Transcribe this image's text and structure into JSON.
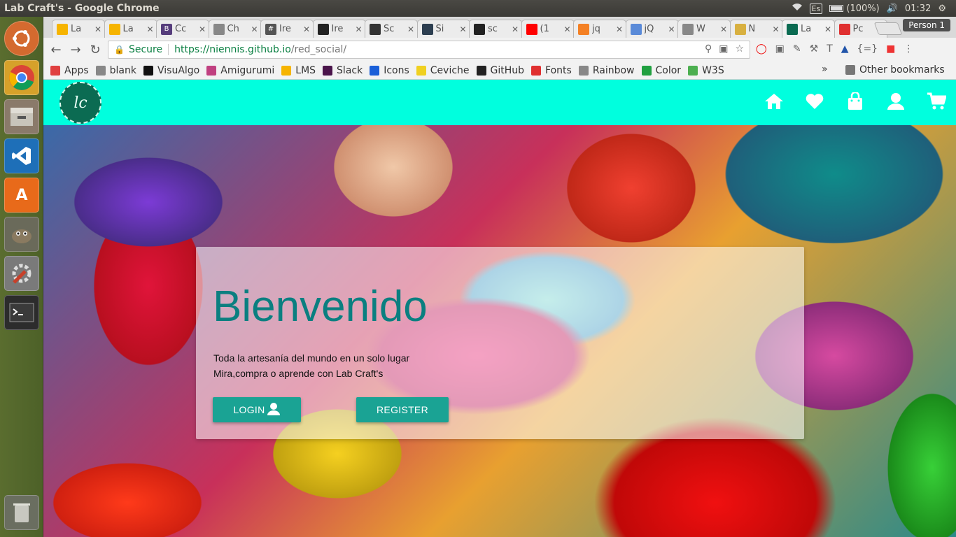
{
  "window": {
    "title": "Lab Craft's - Google Chrome"
  },
  "tray": {
    "keyboard": "Es",
    "battery": "(100%)",
    "time": "01:32"
  },
  "launcher": {
    "apps": [
      {
        "name": "ubuntu-dash-icon",
        "color": "#d46a2f"
      },
      {
        "name": "chrome-icon",
        "color": "#4285f4"
      },
      {
        "name": "files-icon",
        "color": "#8a7a6a"
      },
      {
        "name": "vscode-icon",
        "color": "#1e6fb8"
      },
      {
        "name": "software-center-icon",
        "color": "#e86a1a"
      },
      {
        "name": "gimp-icon",
        "color": "#6a6a5a"
      },
      {
        "name": "settings-icon",
        "color": "#c8402a"
      },
      {
        "name": "terminal-icon",
        "color": "#2c2c2c"
      }
    ],
    "trash": "trash-icon"
  },
  "tabs": [
    {
      "label": "La",
      "icon_color": "#f6b400"
    },
    {
      "label": "La",
      "icon_color": "#f6b400"
    },
    {
      "label": "Cc",
      "icon_color": "#563d7c",
      "glyph": "B"
    },
    {
      "label": "Ch",
      "icon_color": "#888888"
    },
    {
      "label": "Ire",
      "icon_color": "#555555",
      "glyph": "#"
    },
    {
      "label": "Ire",
      "icon_color": "#222222"
    },
    {
      "label": "Sc",
      "icon_color": "#333333"
    },
    {
      "label": "Si",
      "icon_color": "#2c3e50"
    },
    {
      "label": "sc",
      "icon_color": "#222222"
    },
    {
      "label": "(1",
      "icon_color": "#ff0000"
    },
    {
      "label": "jq",
      "icon_color": "#f48024"
    },
    {
      "label": "jQ",
      "icon_color": "#5a8ad8"
    },
    {
      "label": "W",
      "icon_color": "#888888"
    },
    {
      "label": "N",
      "icon_color": "#d8b040"
    },
    {
      "label": "La",
      "icon_color": "#0b6b52",
      "active": true
    },
    {
      "label": "Pc",
      "icon_color": "#e03030"
    }
  ],
  "profile": "Person 1",
  "address": {
    "secure_label": "Secure",
    "host": "https://niennis.github.io",
    "path": "/red_social/"
  },
  "bookmarks": [
    {
      "label": "Apps",
      "icon_color": "#e04040"
    },
    {
      "label": "blank",
      "icon_color": "#888888"
    },
    {
      "label": "VisuAlgo",
      "icon_color": "#111111"
    },
    {
      "label": "Amigurumi",
      "icon_color": "#c04080"
    },
    {
      "label": "LMS",
      "icon_color": "#f6b400"
    },
    {
      "label": "Slack",
      "icon_color": "#4a154b"
    },
    {
      "label": "Icons",
      "icon_color": "#1a5fd8"
    },
    {
      "label": "Ceviche",
      "icon_color": "#f0d020"
    },
    {
      "label": "GitHub",
      "icon_color": "#222222"
    },
    {
      "label": "Fonts",
      "icon_color": "#e03030"
    },
    {
      "label": "Rainbow",
      "icon_color": "#888888"
    },
    {
      "label": "Color",
      "icon_color": "#20a040"
    },
    {
      "label": "W3S",
      "icon_color": "#4caf50"
    }
  ],
  "bookmarks_more": "»",
  "bookmarks_other": "Other bookmarks",
  "site": {
    "nav_bg": "#00ffde",
    "logo_text": "lc",
    "nav_icons": [
      "home-icon",
      "heart-icon",
      "bag-icon",
      "user-icon",
      "cart-icon"
    ],
    "hero": {
      "title": "Bienvenido",
      "line1": "Toda la artesanía del mundo en un solo lugar",
      "line2": "Mira,compra o aprende con Lab Craft's",
      "login": "LOGIN",
      "register": "REGISTER",
      "accent": "#1aa394",
      "title_color": "#0a7f80"
    }
  }
}
